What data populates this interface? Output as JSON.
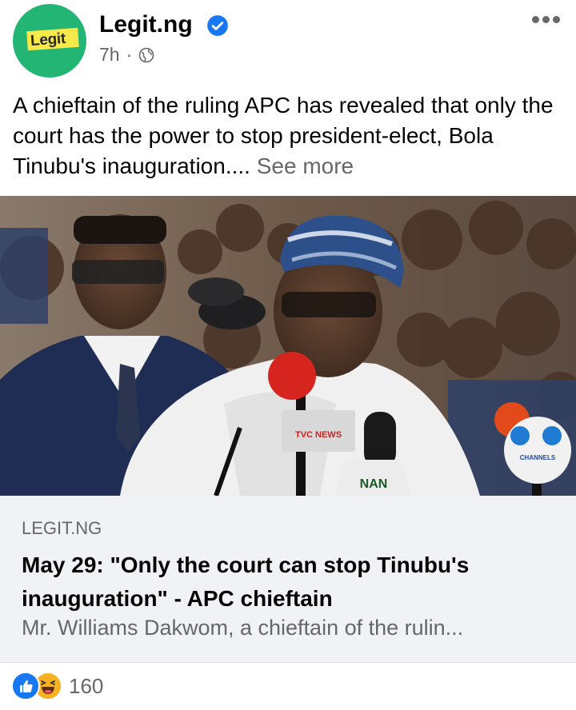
{
  "post": {
    "page_name": "Legit.ng",
    "avatar_logo_text": "Legit",
    "time": "7h",
    "separator": "·",
    "body_text": "A chieftain of the ruling APC has revealed that only the court has the power to stop president-elect, Bola Tinubu's inauguration....",
    "see_more": "See more"
  },
  "photo": {
    "mic_labels": [
      "TVC NEWS",
      "NAN",
      "CHANNELS"
    ]
  },
  "link_preview": {
    "domain": "LEGIT.NG",
    "title": "May 29: \"Only the court can stop Tinubu's inauguration\" - APC chieftain",
    "description": "Mr. Williams Dakwom, a chieftain of the rulin..."
  },
  "reactions": {
    "types": [
      "like-icon",
      "haha-icon"
    ],
    "count": "160"
  },
  "colors": {
    "avatar_bg": "#22b573",
    "logo_bg": "#f7e94a",
    "verified": "#1877f2",
    "secondary_text": "#65676b",
    "card_bg": "#f0f2f5"
  }
}
